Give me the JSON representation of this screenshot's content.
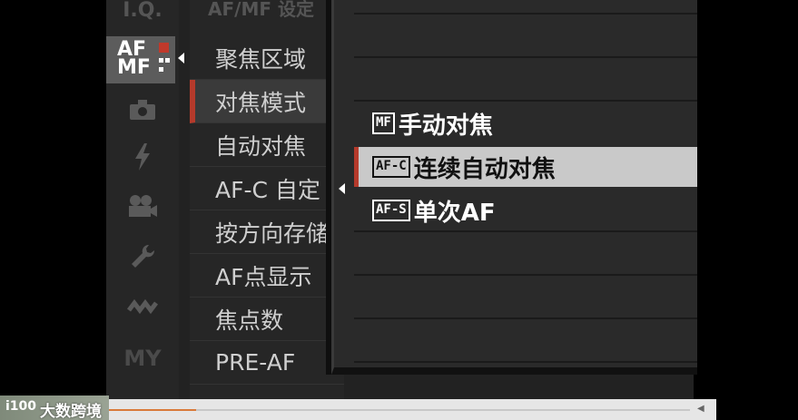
{
  "sidebar": {
    "items": [
      {
        "label": "I.Q.",
        "icon": "iq-icon"
      },
      {
        "label_line1": "AF",
        "label_line2": "MF",
        "icon": "af-mf-icon",
        "active": true
      },
      {
        "icon": "camera-icon"
      },
      {
        "icon": "flash-icon"
      },
      {
        "icon": "movie-icon"
      },
      {
        "icon": "wrench-icon"
      },
      {
        "icon": "wireless-icon"
      },
      {
        "label": "MY",
        "icon": "my-menu-icon"
      }
    ]
  },
  "menu": {
    "header": "AF/MF 设定",
    "items": [
      {
        "label": "聚焦区域"
      },
      {
        "label": "对焦模式",
        "selected": true
      },
      {
        "label": "自动对焦"
      },
      {
        "label": "AF-C 自定"
      },
      {
        "label": "按方向存储"
      },
      {
        "label": "AF点显示"
      },
      {
        "label": "焦点数"
      },
      {
        "label": "PRE-AF"
      }
    ]
  },
  "popup": {
    "options": [
      {
        "icon_text": "MF",
        "label": "手动对焦",
        "selected": false
      },
      {
        "icon_text": "AF-C",
        "label": "连续自动对焦",
        "selected": true
      },
      {
        "icon_text": "AF-S",
        "label": "单次AF",
        "selected": false
      }
    ]
  },
  "player": {
    "progress": 0.15,
    "watermark_text": "大数跨境",
    "watermark_logo": "i100"
  },
  "colors": {
    "accent_red": "#b53a2b",
    "progress": "#d97a3a",
    "selected_row_bg": "#c9c9c9"
  }
}
